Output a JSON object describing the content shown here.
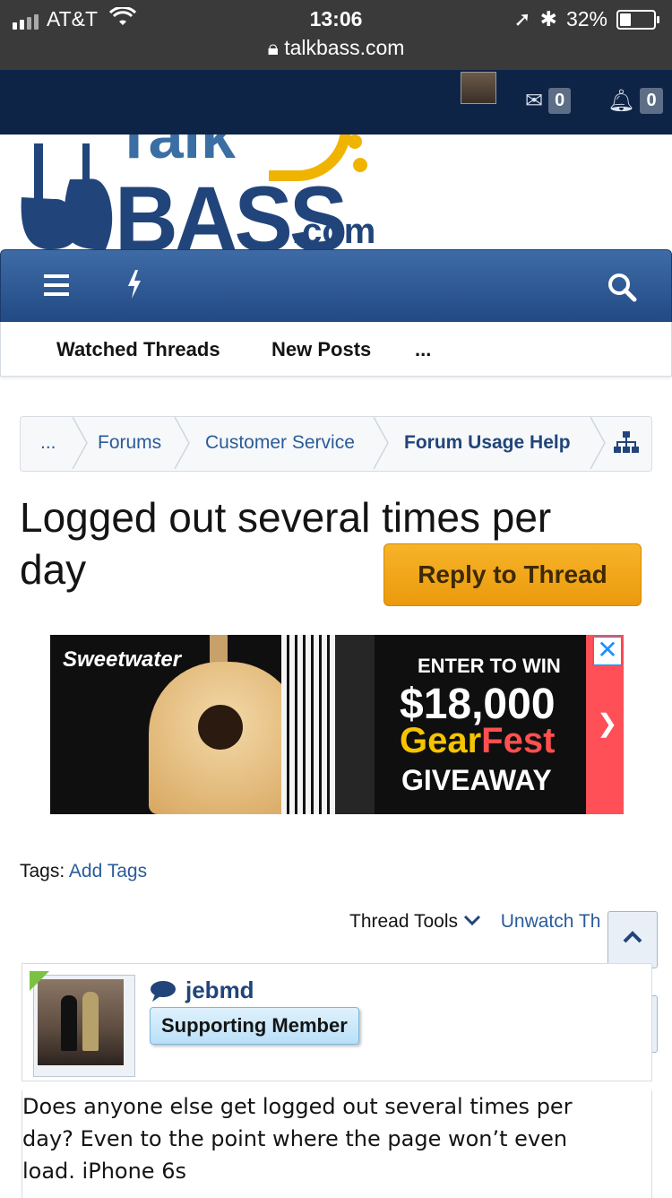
{
  "status_bar": {
    "carrier": "AT&T",
    "time": "13:06",
    "battery": "32%",
    "battery_level": 0.32,
    "url": "talkbass.com"
  },
  "top_nav": {
    "messages_count": "0",
    "alerts_count": "0"
  },
  "logo": {
    "talk": "Talk",
    "bass": "BASS",
    "dotcom": ".com"
  },
  "sub_nav": {
    "watched_threads": "Watched Threads",
    "new_posts": "New Posts",
    "more": "..."
  },
  "breadcrumbs": [
    {
      "label": "..."
    },
    {
      "label": "Forums"
    },
    {
      "label": "Customer Service"
    },
    {
      "label": "Forum Usage Help"
    }
  ],
  "thread": {
    "title": "Logged out several times per day",
    "reply_button": "Reply to Thread"
  },
  "ad": {
    "brand": "Sweetwater",
    "enter": "ENTER TO WIN",
    "amount": "$18,000",
    "gear": "Gear",
    "fest": "Fest",
    "giveaway": "GIVEAWAY"
  },
  "tags": {
    "label": "Tags:",
    "add_tags": "Add Tags"
  },
  "thread_tools": {
    "tools_label": "Thread Tools",
    "unwatch": "Unwatch Th"
  },
  "post": {
    "username": "jebmd",
    "badge": "Supporting Member",
    "body_line1": "Does anyone else get logged out several times per",
    "body_line2": "day? Even to the point where the page won’t even",
    "body_line3": "load. iPhone 6s"
  },
  "colors": {
    "nav_bg": "#0e2446",
    "tab_bar": "#2f5a93",
    "link": "#2a5c99",
    "reply_button": "#f2a71d",
    "badge": "#c9e8fb"
  }
}
